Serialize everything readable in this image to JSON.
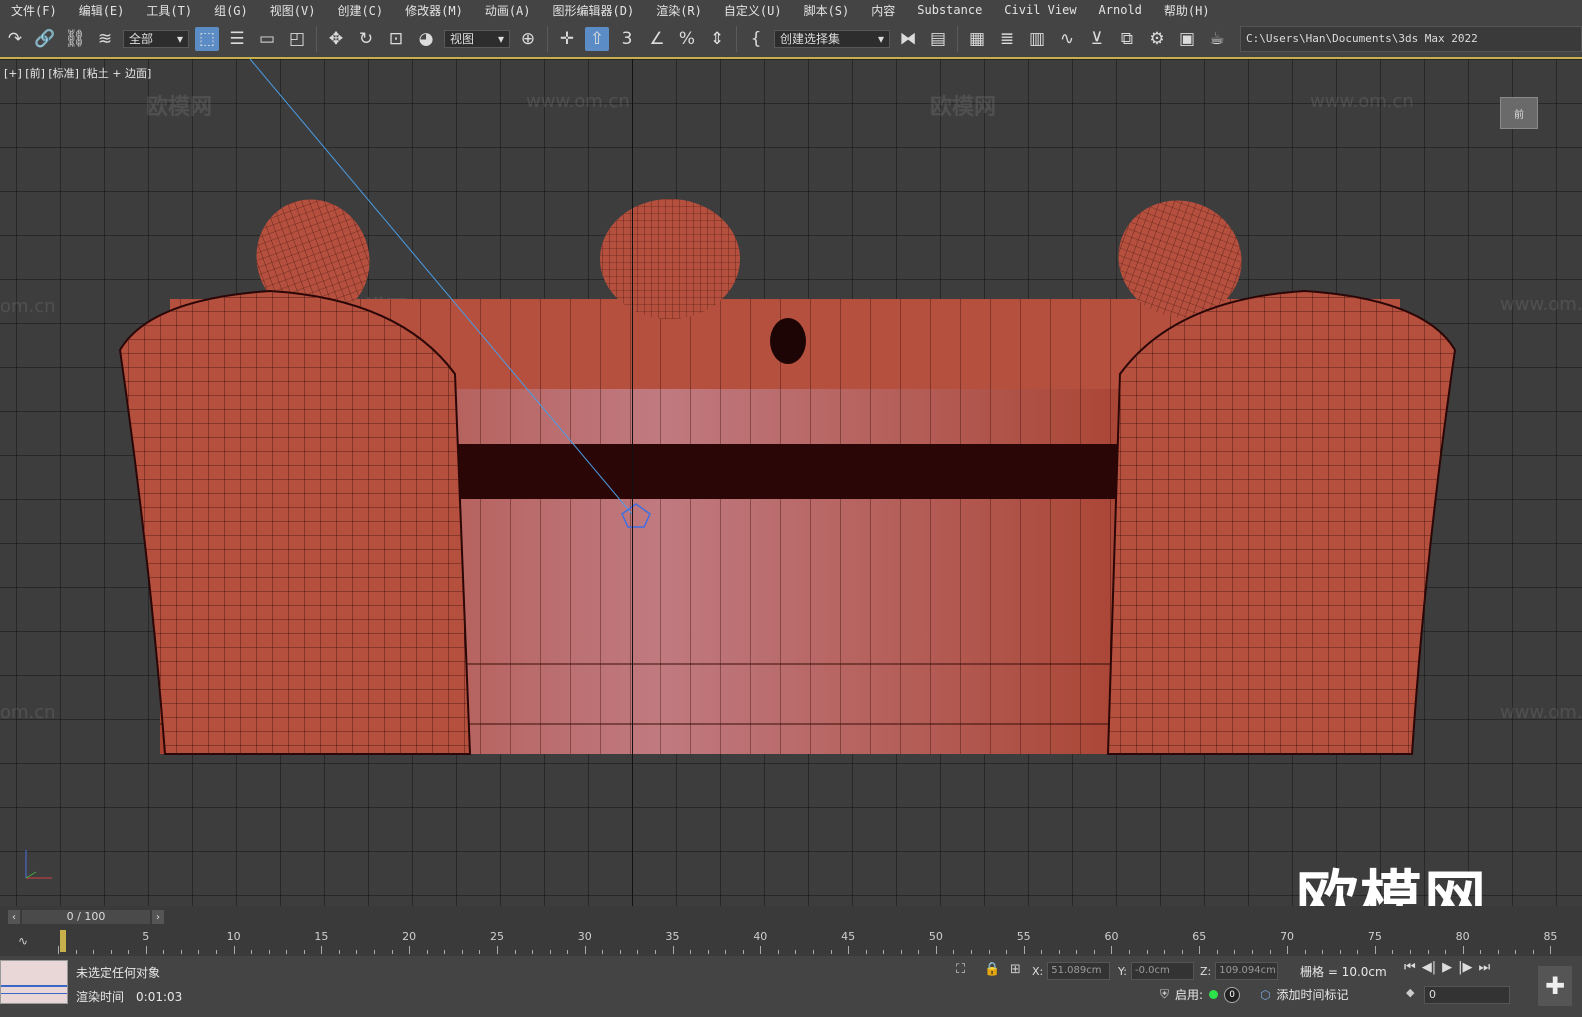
{
  "menu": [
    "文件(F)",
    "编辑(E)",
    "工具(T)",
    "组(G)",
    "视图(V)",
    "创建(C)",
    "修改器(M)",
    "动画(A)",
    "图形编辑器(D)",
    "渲染(R)",
    "自定义(U)",
    "脚本(S)",
    "内容",
    "Substance",
    "Civil View",
    "Arnold",
    "帮助(H)"
  ],
  "toolbar": {
    "filter_value": "全部",
    "refcoord_value": "视图",
    "selection_set_value": "创建选择集",
    "project_path": "C:\\Users\\Han\\Documents\\3ds Max 2022"
  },
  "viewport": {
    "label": "[+] [前] [标准] [粘土 + 边面]",
    "navcube_label": "前",
    "watermark_logo": "欧模网",
    "watermark_url": "www.om.cn",
    "watermark_url_short": "om.cn",
    "brand": "欧模网"
  },
  "timeline": {
    "frame_display": "0 / 100",
    "ticks": [
      "5",
      "10",
      "15",
      "20",
      "25",
      "30",
      "35",
      "40",
      "45",
      "50",
      "55",
      "60",
      "65",
      "70",
      "75",
      "80",
      "85"
    ]
  },
  "status": {
    "selection": "未选定任何对象",
    "render_time_label": "渲染时间",
    "render_time_value": "0:01:03",
    "x_label": "X:",
    "x_value": "51.089cm",
    "y_label": "Y:",
    "y_value": "-0.0cm",
    "z_label": "Z:",
    "z_value": "109.094cm",
    "grid": "栅格 = 10.0cm",
    "enable_label": "启用:",
    "enable_count": "0",
    "add_time_tag": "添加时间标记",
    "current_frame": "0"
  },
  "colors": {
    "model_red": "#b5503f",
    "accent_active": "#5c8cc6",
    "timeline_marker": "#c8b04a"
  }
}
